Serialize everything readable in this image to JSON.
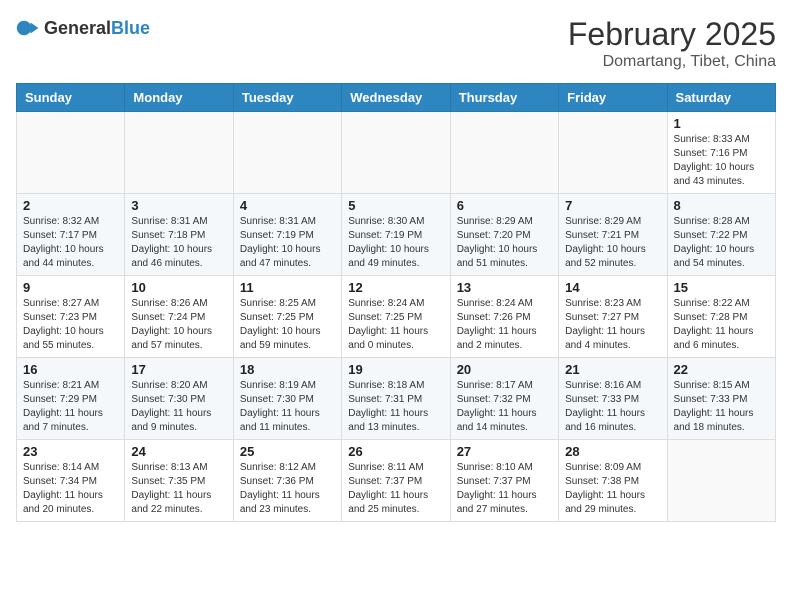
{
  "header": {
    "logo_general": "General",
    "logo_blue": "Blue",
    "month_title": "February 2025",
    "location": "Domartang, Tibet, China"
  },
  "days_of_week": [
    "Sunday",
    "Monday",
    "Tuesday",
    "Wednesday",
    "Thursday",
    "Friday",
    "Saturday"
  ],
  "weeks": [
    [
      {
        "day": "",
        "info": ""
      },
      {
        "day": "",
        "info": ""
      },
      {
        "day": "",
        "info": ""
      },
      {
        "day": "",
        "info": ""
      },
      {
        "day": "",
        "info": ""
      },
      {
        "day": "",
        "info": ""
      },
      {
        "day": "1",
        "info": "Sunrise: 8:33 AM\nSunset: 7:16 PM\nDaylight: 10 hours and 43 minutes."
      }
    ],
    [
      {
        "day": "2",
        "info": "Sunrise: 8:32 AM\nSunset: 7:17 PM\nDaylight: 10 hours and 44 minutes."
      },
      {
        "day": "3",
        "info": "Sunrise: 8:31 AM\nSunset: 7:18 PM\nDaylight: 10 hours and 46 minutes."
      },
      {
        "day": "4",
        "info": "Sunrise: 8:31 AM\nSunset: 7:19 PM\nDaylight: 10 hours and 47 minutes."
      },
      {
        "day": "5",
        "info": "Sunrise: 8:30 AM\nSunset: 7:19 PM\nDaylight: 10 hours and 49 minutes."
      },
      {
        "day": "6",
        "info": "Sunrise: 8:29 AM\nSunset: 7:20 PM\nDaylight: 10 hours and 51 minutes."
      },
      {
        "day": "7",
        "info": "Sunrise: 8:29 AM\nSunset: 7:21 PM\nDaylight: 10 hours and 52 minutes."
      },
      {
        "day": "8",
        "info": "Sunrise: 8:28 AM\nSunset: 7:22 PM\nDaylight: 10 hours and 54 minutes."
      }
    ],
    [
      {
        "day": "9",
        "info": "Sunrise: 8:27 AM\nSunset: 7:23 PM\nDaylight: 10 hours and 55 minutes."
      },
      {
        "day": "10",
        "info": "Sunrise: 8:26 AM\nSunset: 7:24 PM\nDaylight: 10 hours and 57 minutes."
      },
      {
        "day": "11",
        "info": "Sunrise: 8:25 AM\nSunset: 7:25 PM\nDaylight: 10 hours and 59 minutes."
      },
      {
        "day": "12",
        "info": "Sunrise: 8:24 AM\nSunset: 7:25 PM\nDaylight: 11 hours and 0 minutes."
      },
      {
        "day": "13",
        "info": "Sunrise: 8:24 AM\nSunset: 7:26 PM\nDaylight: 11 hours and 2 minutes."
      },
      {
        "day": "14",
        "info": "Sunrise: 8:23 AM\nSunset: 7:27 PM\nDaylight: 11 hours and 4 minutes."
      },
      {
        "day": "15",
        "info": "Sunrise: 8:22 AM\nSunset: 7:28 PM\nDaylight: 11 hours and 6 minutes."
      }
    ],
    [
      {
        "day": "16",
        "info": "Sunrise: 8:21 AM\nSunset: 7:29 PM\nDaylight: 11 hours and 7 minutes."
      },
      {
        "day": "17",
        "info": "Sunrise: 8:20 AM\nSunset: 7:30 PM\nDaylight: 11 hours and 9 minutes."
      },
      {
        "day": "18",
        "info": "Sunrise: 8:19 AM\nSunset: 7:30 PM\nDaylight: 11 hours and 11 minutes."
      },
      {
        "day": "19",
        "info": "Sunrise: 8:18 AM\nSunset: 7:31 PM\nDaylight: 11 hours and 13 minutes."
      },
      {
        "day": "20",
        "info": "Sunrise: 8:17 AM\nSunset: 7:32 PM\nDaylight: 11 hours and 14 minutes."
      },
      {
        "day": "21",
        "info": "Sunrise: 8:16 AM\nSunset: 7:33 PM\nDaylight: 11 hours and 16 minutes."
      },
      {
        "day": "22",
        "info": "Sunrise: 8:15 AM\nSunset: 7:33 PM\nDaylight: 11 hours and 18 minutes."
      }
    ],
    [
      {
        "day": "23",
        "info": "Sunrise: 8:14 AM\nSunset: 7:34 PM\nDaylight: 11 hours and 20 minutes."
      },
      {
        "day": "24",
        "info": "Sunrise: 8:13 AM\nSunset: 7:35 PM\nDaylight: 11 hours and 22 minutes."
      },
      {
        "day": "25",
        "info": "Sunrise: 8:12 AM\nSunset: 7:36 PM\nDaylight: 11 hours and 23 minutes."
      },
      {
        "day": "26",
        "info": "Sunrise: 8:11 AM\nSunset: 7:37 PM\nDaylight: 11 hours and 25 minutes."
      },
      {
        "day": "27",
        "info": "Sunrise: 8:10 AM\nSunset: 7:37 PM\nDaylight: 11 hours and 27 minutes."
      },
      {
        "day": "28",
        "info": "Sunrise: 8:09 AM\nSunset: 7:38 PM\nDaylight: 11 hours and 29 minutes."
      },
      {
        "day": "",
        "info": ""
      }
    ]
  ]
}
